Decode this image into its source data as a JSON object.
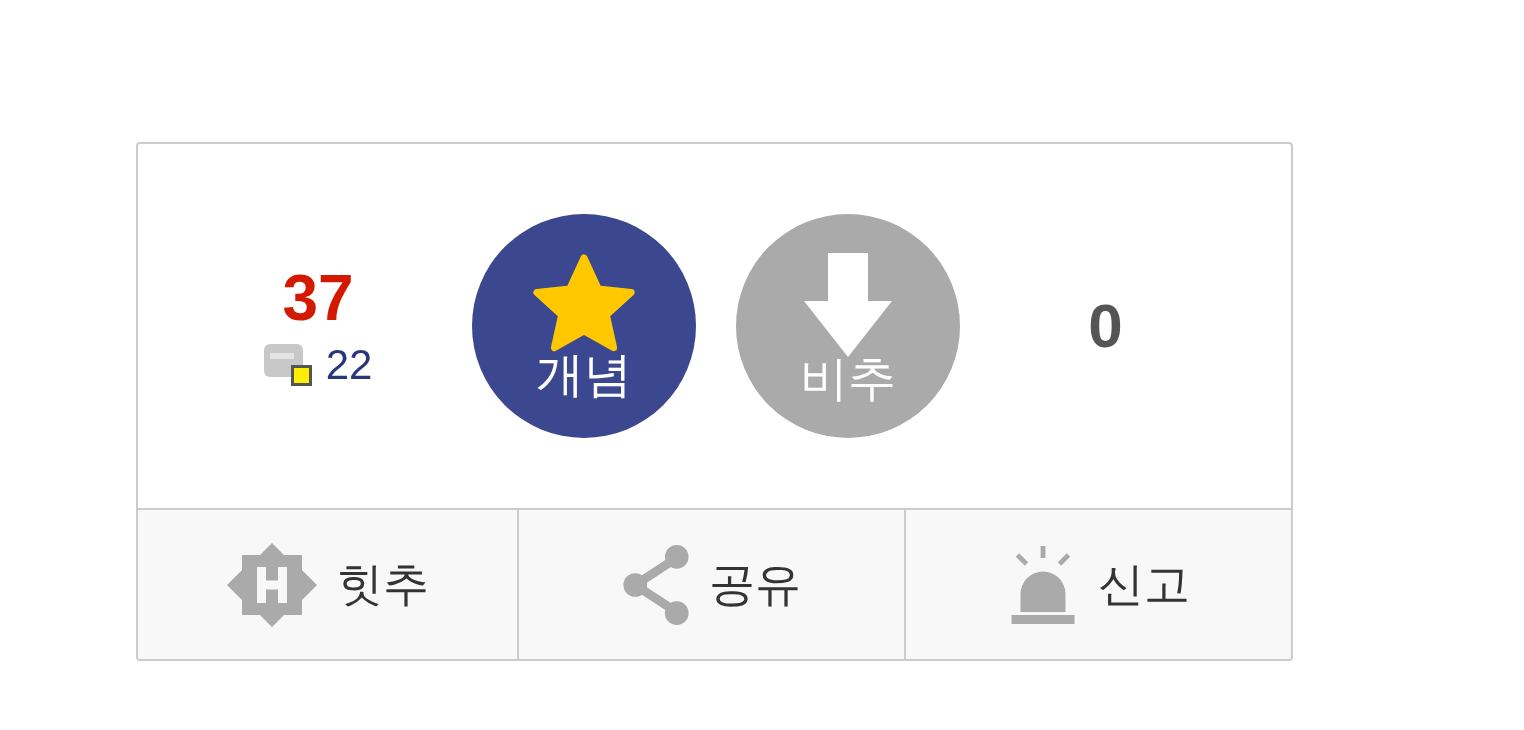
{
  "recommend_count": "37",
  "fixed_count": "22",
  "vote_buttons": [
    {
      "label": "개념",
      "kind": "up"
    },
    {
      "label": "비추",
      "kind": "down"
    }
  ],
  "unrecommend_count": "0",
  "actions": [
    {
      "label": "힛추",
      "kind": "hit"
    },
    {
      "label": "공유",
      "kind": "share"
    },
    {
      "label": "신고",
      "kind": "report"
    }
  ]
}
